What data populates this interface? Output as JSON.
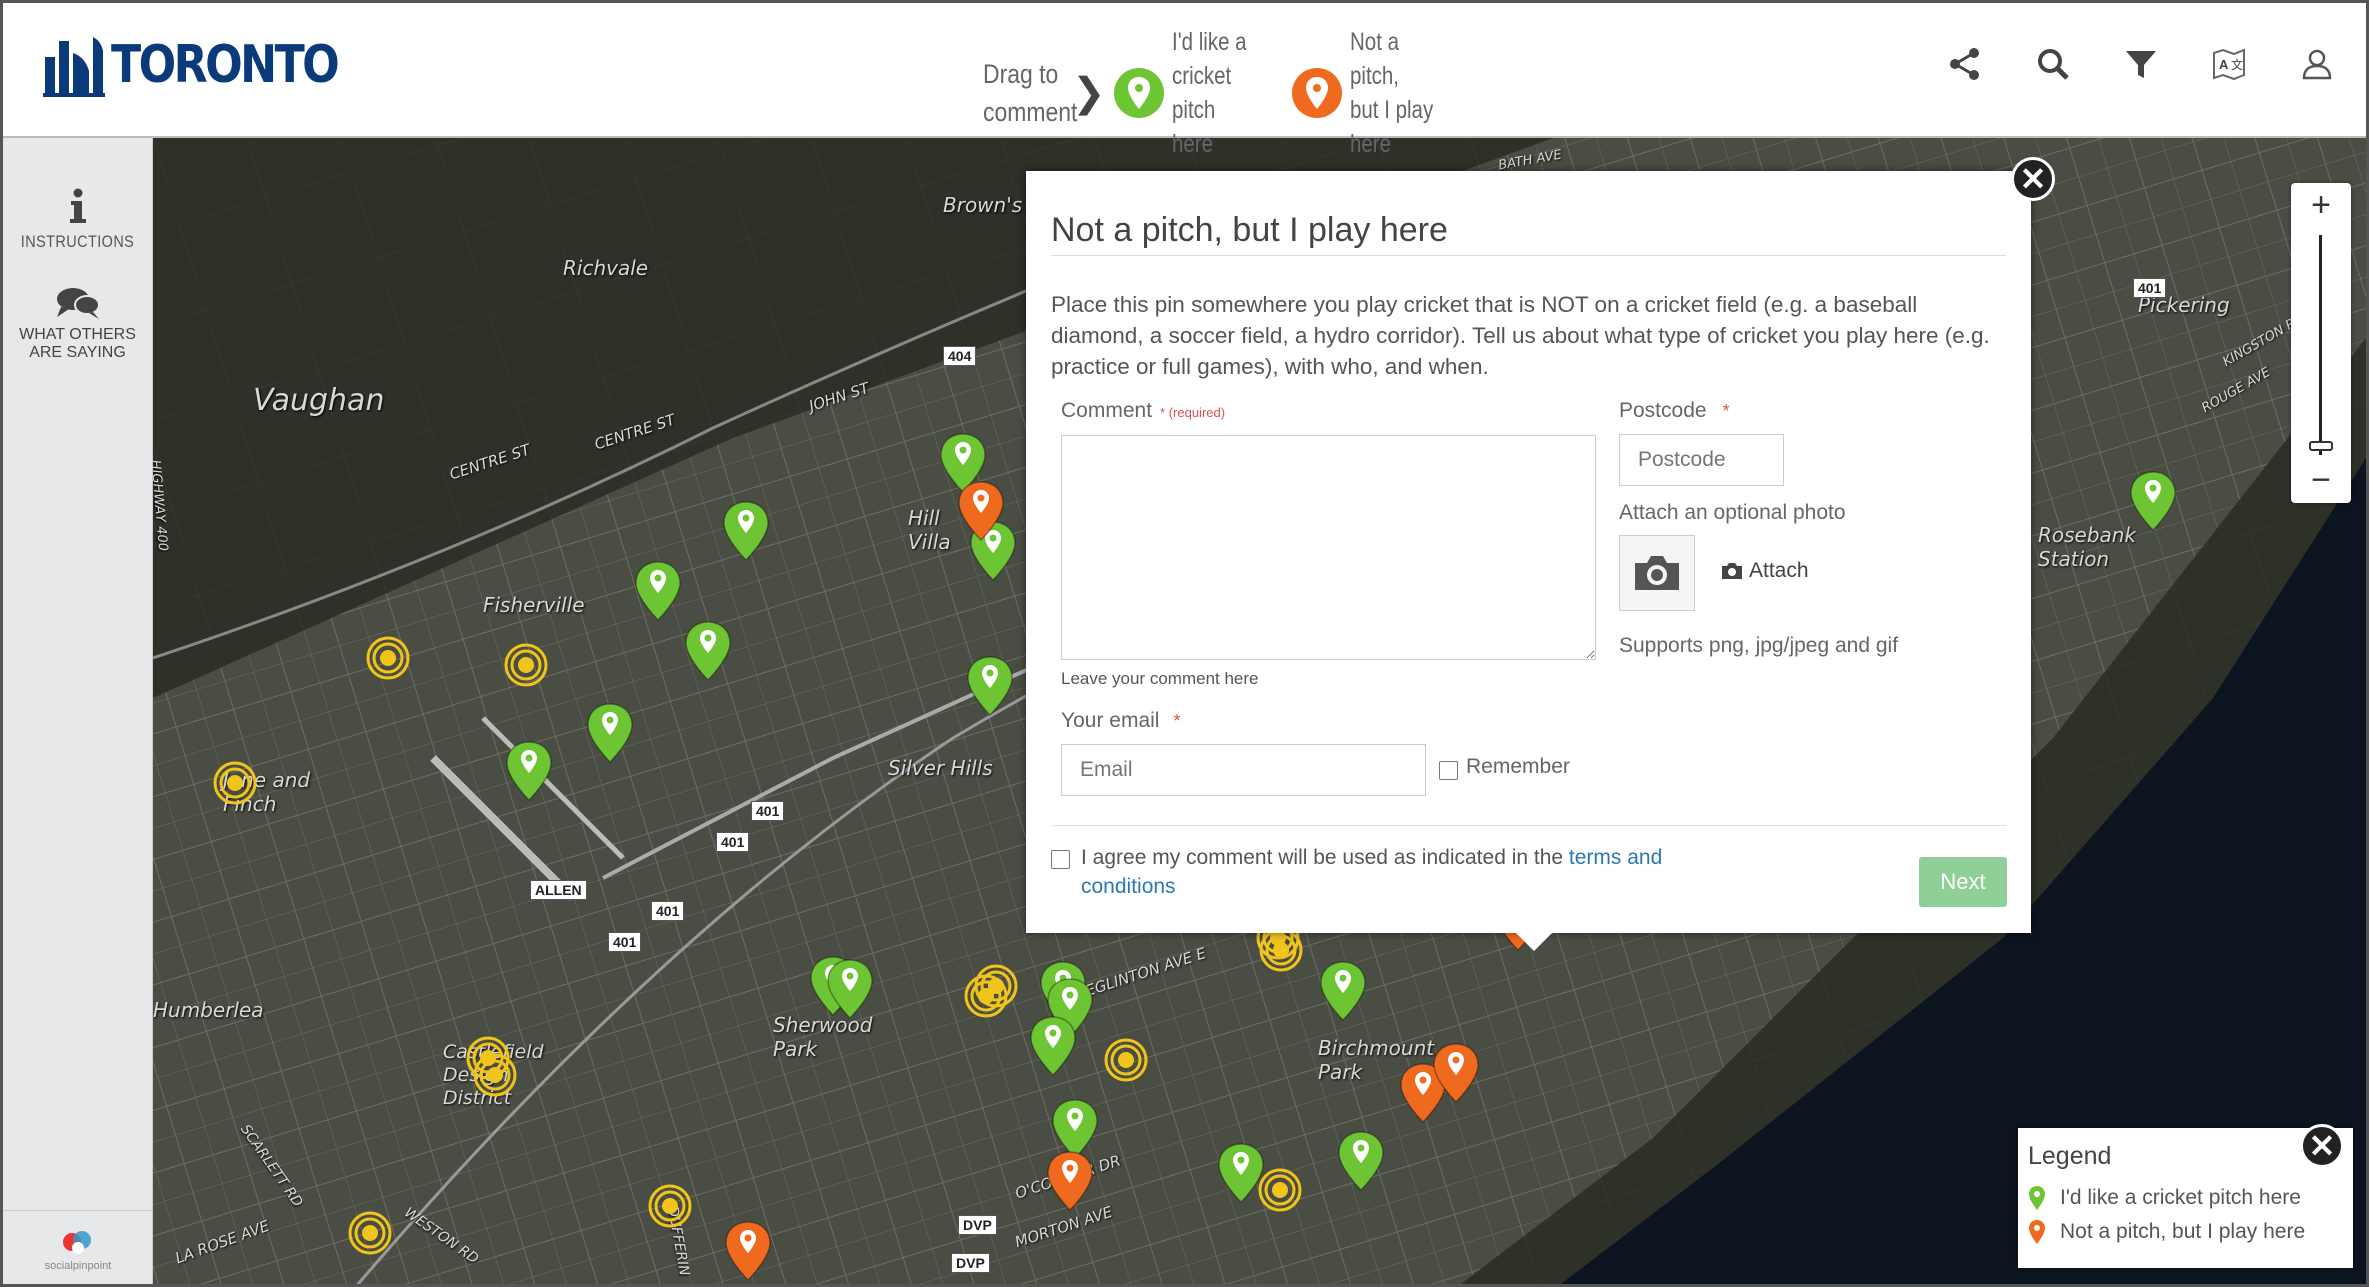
{
  "header": {
    "logo_text": "TORONTO",
    "drag_to_comment": [
      "Drag to",
      "comment"
    ],
    "pins": [
      {
        "label": [
          "I'd like a",
          "cricket pitch",
          "here"
        ],
        "color": "#6ec534"
      },
      {
        "label": [
          "Not a pitch,",
          "but I play",
          "here"
        ],
        "color": "#ef6a1f"
      }
    ],
    "icons": [
      "share-icon",
      "search-icon",
      "filter-icon",
      "map-language-icon",
      "user-icon"
    ]
  },
  "sidebar": {
    "items": [
      {
        "label": "INSTRUCTIONS",
        "icon": "info-icon"
      },
      {
        "label_lines": [
          "WHAT OTHERS",
          "ARE SAYING"
        ],
        "icon": "speech-bubble-icon"
      }
    ],
    "brand": "socialpinpoint"
  },
  "map": {
    "places": [
      "Brown's Corners",
      "Richvale",
      "Vaughan",
      "Fisherville",
      "Hill Villa",
      "Silver Hills",
      "Jane and Finch",
      "Humberlea",
      "Castlefield Design District",
      "Sherwood Park",
      "Birchmount Park",
      "Rosebank Station",
      "Pickering"
    ],
    "streets": [
      "CENTRE ST",
      "CENTRE ST",
      "JOHN ST",
      "HIGHWAY 400",
      "SCARLETT RD",
      "LA ROSE AVE",
      "WESTON RD",
      "DUFFERIN",
      "O'CONNOR DR",
      "MORTON AVE",
      "EGLINTON AVE E",
      "BATH AVE",
      "ROUGE AVE",
      "KINGSTON RD"
    ],
    "shields": [
      "404",
      "401",
      "401",
      "401",
      "401",
      "ALLEN",
      "DVP",
      "DVP",
      "401"
    ],
    "colors": {
      "green_pin": "#6ec534",
      "orange_pin": "#ef6a1f",
      "cluster": "#f0c419",
      "water": "#0c1420",
      "land": "#2a2e26"
    }
  },
  "zoom": {
    "in": "+",
    "out": "−"
  },
  "dialog": {
    "title": "Not a pitch, but I play here",
    "description": "Place this pin somewhere you play cricket that is NOT on a cricket field (e.g. a baseball diamond, a soccer field, a hydro corridor). Tell us about what type of cricket you play here (e.g. practice or full games), with who, and when.",
    "comment_label": "Comment",
    "comment_required": "* (required)",
    "comment_hint": "Leave your comment here",
    "postcode_label": "Postcode",
    "postcode_required": "*",
    "postcode_placeholder": "Postcode",
    "photo_label": "Attach an optional photo",
    "attach_label": "Attach",
    "photo_formats": "Supports png, jpg/jpeg and gif",
    "email_label": "Your email",
    "email_required": "*",
    "email_placeholder": "Email",
    "remember_label": "Remember",
    "agree_text": "I agree my comment will be used as indicated in the ",
    "terms_link": "terms and conditions",
    "next_label": "Next",
    "close": "✕"
  },
  "legend": {
    "title": "Legend",
    "items": [
      {
        "label": "I'd like a cricket pitch here",
        "color": "#6ec534"
      },
      {
        "label": "Not a pitch, but I play here",
        "color": "#ef6a1f"
      }
    ],
    "close": "✕"
  }
}
